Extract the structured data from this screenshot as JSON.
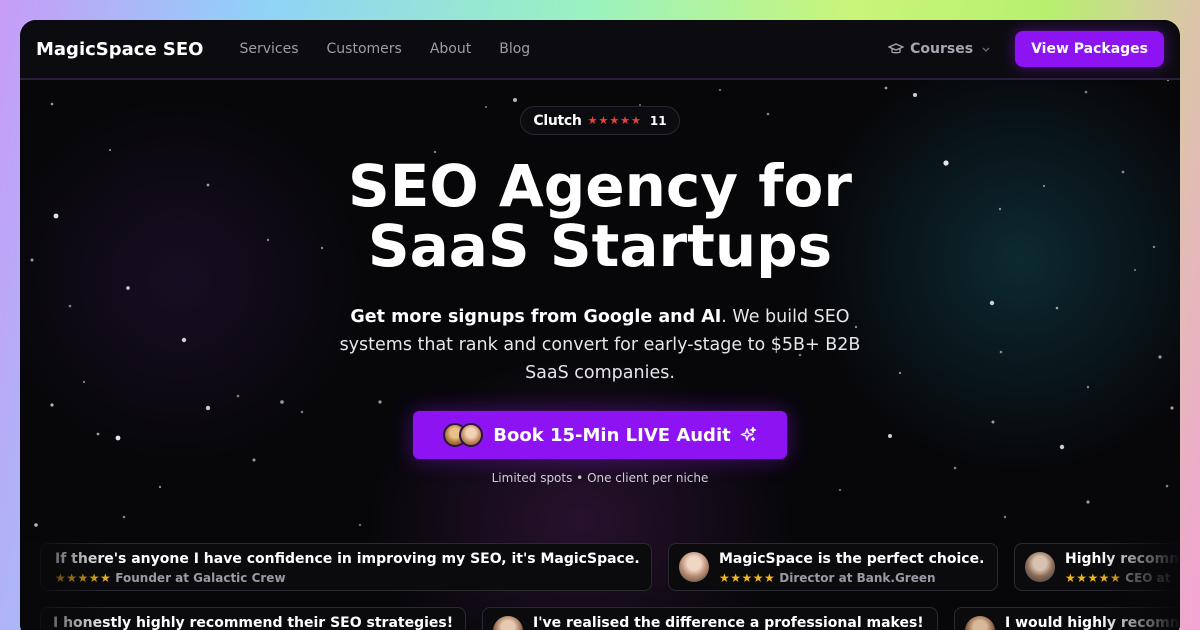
{
  "nav": {
    "brand": "MagicSpace SEO",
    "links": [
      "Services",
      "Customers",
      "About",
      "Blog"
    ],
    "courses_label": "Courses",
    "cta_label": "View Packages"
  },
  "hero": {
    "badge": {
      "name": "Clutch",
      "stars": "★★★★★",
      "count": "11"
    },
    "headline_line1": "SEO Agency for",
    "headline_line2": "SaaS Startups",
    "sub_bold": "Get more signups from Google and AI",
    "sub_rest": ". We build SEO systems that rank and convert for early-stage to $5B+ B2B SaaS companies.",
    "cta_label": "Book 15-Min LIVE Audit",
    "note": "Limited spots • One client per niche"
  },
  "reviews_row1": [
    {
      "quote": "If there's anyone I have confidence in improving my SEO, it's MagicSpace.",
      "stars": "★★★★★",
      "role": "Founder at Galactic Crew"
    },
    {
      "quote": "MagicSpace is the perfect choice.",
      "stars": "★★★★★",
      "role": "Director at Bank.Green"
    },
    {
      "quote": "Highly recommend",
      "stars": "★★★★★",
      "role": "CEO at"
    }
  ],
  "reviews_row2": [
    {
      "quote": "I honestly highly recommend their SEO strategies!"
    },
    {
      "quote": "I've realised the difference a professional makes!"
    },
    {
      "quote": "I would highly recommend"
    }
  ],
  "colors": {
    "accent": "#8e13f2",
    "star_gold": "#f3b51e",
    "clutch_red": "#e5423b"
  }
}
